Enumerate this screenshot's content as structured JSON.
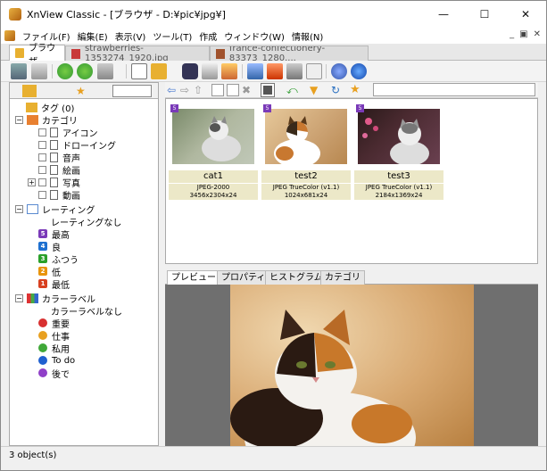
{
  "window": {
    "title": "XnView Classic - [ブラウザ - D:¥pic¥jpg¥]"
  },
  "menu": [
    "ファイル(F)",
    "編集(E)",
    "表示(V)",
    "ツール(T)",
    "作成",
    "ウィンドウ(W)",
    "情報(N)"
  ],
  "tabs": [
    {
      "label": "ブラウザ",
      "active": true
    },
    {
      "label": "strawberries-1353274_1920.jpg",
      "active": false
    },
    {
      "label": "france-confectionery-83373_1280....",
      "active": false
    }
  ],
  "tree": {
    "tags": "タグ (0)",
    "category": "カテゴリ",
    "category_items": [
      "アイコン",
      "ドローイング",
      "音声",
      "絵画",
      "写真",
      "動画"
    ],
    "rating": "レーティング",
    "rating_items": [
      {
        "label": "レーティングなし",
        "badge": ""
      },
      {
        "label": "最高",
        "badge": "5",
        "color": "#7a3ab8"
      },
      {
        "label": "良",
        "badge": "4",
        "color": "#1e70d0"
      },
      {
        "label": "ふつう",
        "badge": "3",
        "color": "#2aa02a"
      },
      {
        "label": "低",
        "badge": "2",
        "color": "#e8940c"
      },
      {
        "label": "最低",
        "badge": "1",
        "color": "#d84020"
      }
    ],
    "color_label": "カラーラベル",
    "color_items": [
      {
        "label": "カラーラベルなし",
        "color": ""
      },
      {
        "label": "重要",
        "color": "#d83030"
      },
      {
        "label": "仕事",
        "color": "#e8a020"
      },
      {
        "label": "私用",
        "color": "#40a838"
      },
      {
        "label": "To do",
        "color": "#2060d0"
      },
      {
        "label": "後で",
        "color": "#9040c8"
      }
    ]
  },
  "thumbnails": [
    {
      "name": "cat1",
      "format": "JPEG-2000",
      "size": "3456x2304x24",
      "badge": "5"
    },
    {
      "name": "test2",
      "format": "JPEG TrueColor (v1.1)",
      "size": "1024x681x24",
      "badge": "5"
    },
    {
      "name": "test3",
      "format": "JPEG TrueColor (v1.1)",
      "size": "2184x1369x24",
      "badge": "5"
    }
  ],
  "preview_tabs": [
    "プレビュー",
    "プロパティ",
    "ヒストグラム",
    "カテゴリ"
  ],
  "status": "3 object(s)",
  "colors": {
    "selection": "#ece8c8",
    "preview_bg": "#6f6f6f",
    "accent": "#7a3ab8"
  }
}
